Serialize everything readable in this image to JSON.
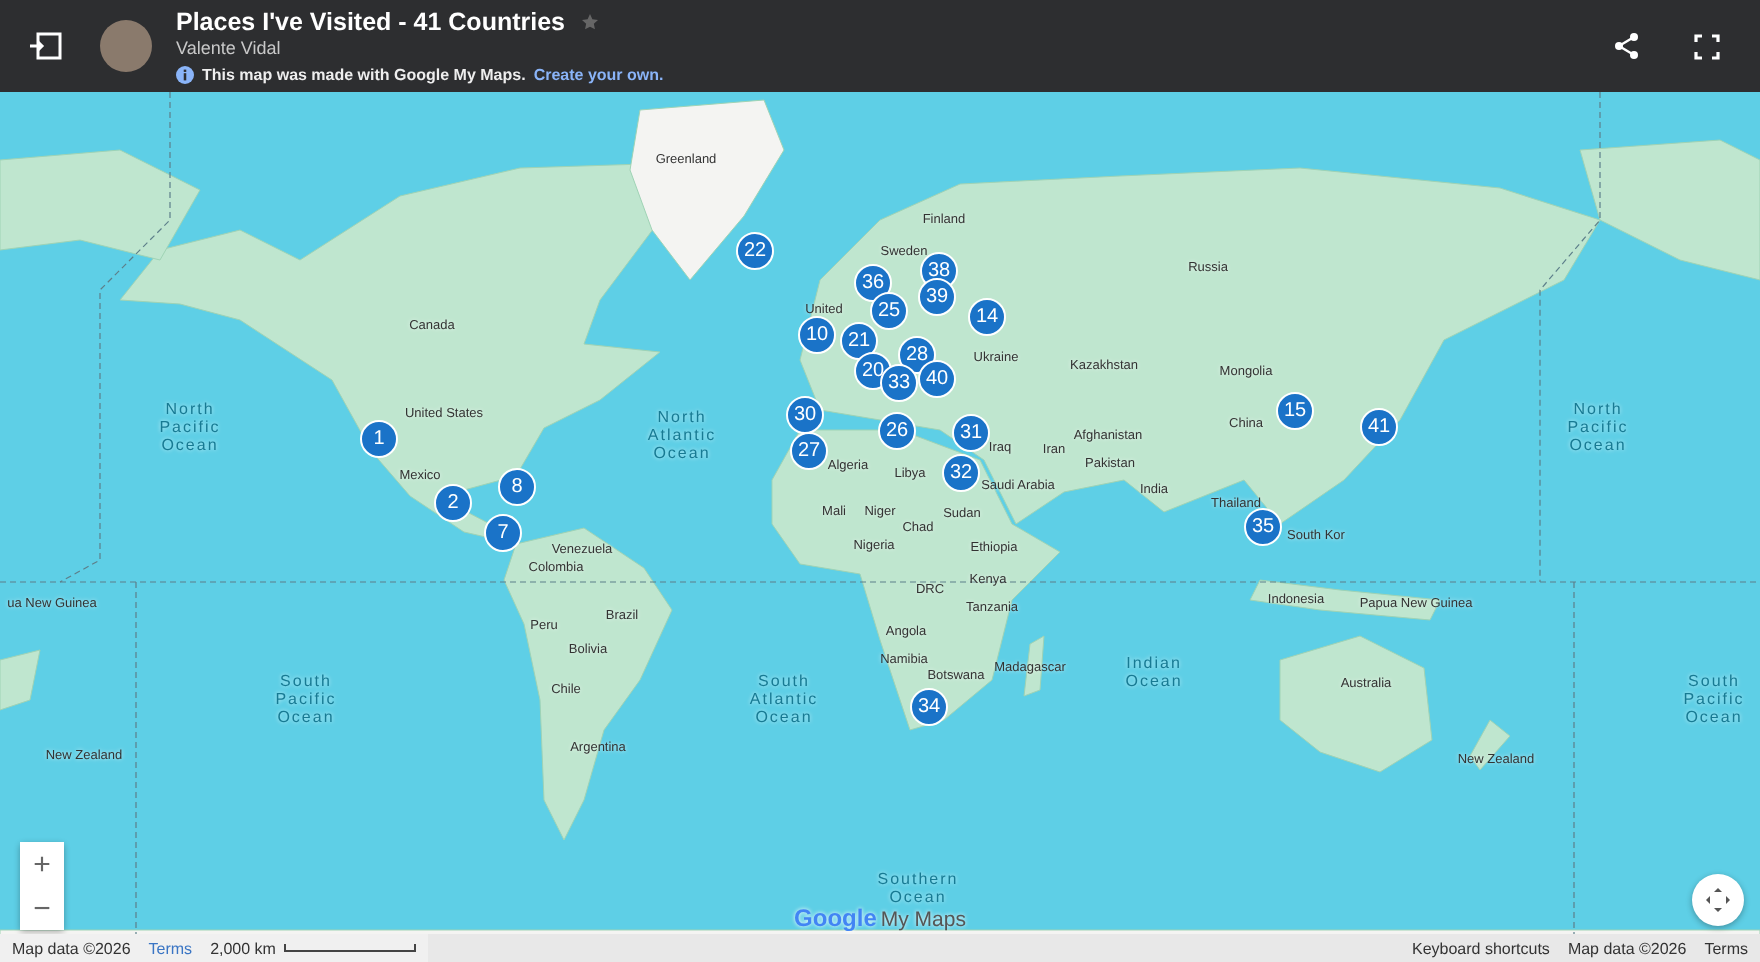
{
  "header": {
    "title": "Places I've Visited - 41 Countries",
    "author": "Valente Vidal",
    "notice": "This map was made with Google My Maps.",
    "notice_link": "Create your own."
  },
  "map": {
    "labels": [
      {
        "kind": "country",
        "text": "Greenland"
      },
      {
        "kind": "country",
        "text": "Finland"
      },
      {
        "kind": "country",
        "text": "Sweden"
      },
      {
        "kind": "country",
        "text": "Russia"
      },
      {
        "kind": "country",
        "text": "Canada"
      },
      {
        "kind": "country",
        "text": "United"
      },
      {
        "kind": "country",
        "text": "United States"
      },
      {
        "kind": "country",
        "text": "Mexico"
      },
      {
        "kind": "country",
        "text": "Kazakhstan"
      },
      {
        "kind": "country",
        "text": "Mongolia"
      },
      {
        "kind": "country",
        "text": "Ukraine"
      },
      {
        "kind": "country",
        "text": "China"
      },
      {
        "kind": "country",
        "text": "South Kor"
      },
      {
        "kind": "country",
        "text": "Iraq"
      },
      {
        "kind": "country",
        "text": "Iran"
      },
      {
        "kind": "country",
        "text": "Afghanistan"
      },
      {
        "kind": "country",
        "text": "Pakistan"
      },
      {
        "kind": "country",
        "text": "India"
      },
      {
        "kind": "country",
        "text": "Algeria"
      },
      {
        "kind": "country",
        "text": "Libya"
      },
      {
        "kind": "country",
        "text": "Saudi Arabia"
      },
      {
        "kind": "country",
        "text": "Mali"
      },
      {
        "kind": "country",
        "text": "Niger"
      },
      {
        "kind": "country",
        "text": "Chad"
      },
      {
        "kind": "country",
        "text": "Sudan"
      },
      {
        "kind": "country",
        "text": "Nigeria"
      },
      {
        "kind": "country",
        "text": "Ethiopia"
      },
      {
        "kind": "country",
        "text": "Kenya"
      },
      {
        "kind": "country",
        "text": "DRC"
      },
      {
        "kind": "country",
        "text": "Tanzania"
      },
      {
        "kind": "country",
        "text": "Angola"
      },
      {
        "kind": "country",
        "text": "Namibia"
      },
      {
        "kind": "country",
        "text": "Botswana"
      },
      {
        "kind": "country",
        "text": "Madagascar"
      },
      {
        "kind": "country",
        "text": "Thailand"
      },
      {
        "kind": "country",
        "text": "Indonesia"
      },
      {
        "kind": "country",
        "text": "Papua New Guinea"
      },
      {
        "kind": "country",
        "text": "Australia"
      },
      {
        "kind": "country",
        "text": "New Zealand"
      },
      {
        "kind": "country",
        "text": "Venezuela"
      },
      {
        "kind": "country",
        "text": "Colombia"
      },
      {
        "kind": "country",
        "text": "Brazil"
      },
      {
        "kind": "country",
        "text": "Peru"
      },
      {
        "kind": "country",
        "text": "Bolivia"
      },
      {
        "kind": "country",
        "text": "Chile"
      },
      {
        "kind": "country",
        "text": "Argentina"
      },
      {
        "kind": "country",
        "text": "New Zealand"
      },
      {
        "kind": "country",
        "text": "ua New Guinea"
      },
      {
        "kind": "ocean",
        "text": "North Pacific Ocean"
      },
      {
        "kind": "ocean",
        "text": "North Atlantic Ocean"
      },
      {
        "kind": "ocean",
        "text": "North Pacific Ocean"
      },
      {
        "kind": "ocean",
        "text": "South Pacific Ocean"
      },
      {
        "kind": "ocean",
        "text": "South Atlantic Ocean"
      },
      {
        "kind": "ocean",
        "text": "Indian Ocean"
      },
      {
        "kind": "ocean",
        "text": "South Pacific Ocean"
      },
      {
        "kind": "ocean",
        "text": "Southern Ocean"
      }
    ],
    "markers": [
      "1",
      "2",
      "8",
      "7",
      "22",
      "36",
      "25",
      "38",
      "39",
      "14",
      "10",
      "21",
      "28",
      "20",
      "33",
      "40",
      "30",
      "27",
      "26",
      "31",
      "32",
      "34",
      "15",
      "41",
      "35"
    ]
  },
  "zoom": {
    "in": "+",
    "out": "−"
  },
  "logo": {
    "brand": "Google",
    "product": "My Maps"
  },
  "footer": {
    "left": [
      {
        "kind": "text",
        "text": "Map data ©2026"
      },
      {
        "kind": "link",
        "text": "Terms"
      },
      {
        "kind": "scale",
        "text": "2,000 km"
      }
    ],
    "right": [
      "Keyboard shortcuts",
      "Map data ©2026",
      "Terms"
    ]
  }
}
